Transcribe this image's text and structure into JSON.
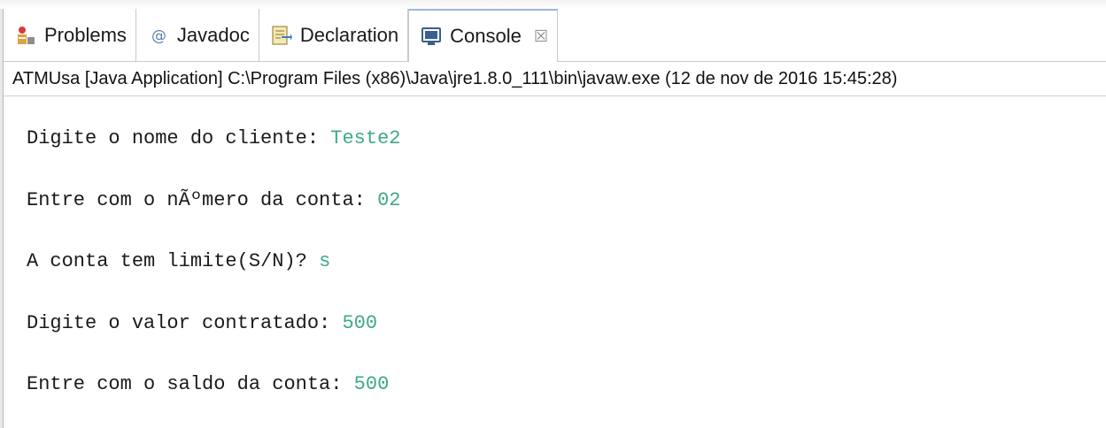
{
  "tabs": [
    {
      "label": "Problems",
      "icon": "problems-icon",
      "active": false
    },
    {
      "label": "Javadoc",
      "icon": "javadoc-icon",
      "active": false
    },
    {
      "label": "Declaration",
      "icon": "declaration-icon",
      "active": false
    },
    {
      "label": "Console",
      "icon": "console-icon",
      "active": true,
      "close_glyph": "☒"
    }
  ],
  "status": "ATMUsa [Java Application] C:\\Program Files (x86)\\Java\\jre1.8.0_111\\bin\\javaw.exe (12 de nov de 2016 15:45:28)",
  "console": {
    "lines": [
      {
        "prompt": "Digite o nome do cliente: ",
        "input": "Teste2"
      },
      {
        "prompt": "Entre com o nÃºmero da conta: ",
        "input": "02"
      },
      {
        "prompt": "A conta tem limite(S/N)? ",
        "input": "s"
      },
      {
        "prompt": "Digite o valor contratado: ",
        "input": "500"
      },
      {
        "prompt": "Entre com o saldo da conta: ",
        "input": "500"
      }
    ]
  },
  "colors": {
    "input_text": "#3daa8b",
    "active_tab_border": "#9fb8d8"
  }
}
